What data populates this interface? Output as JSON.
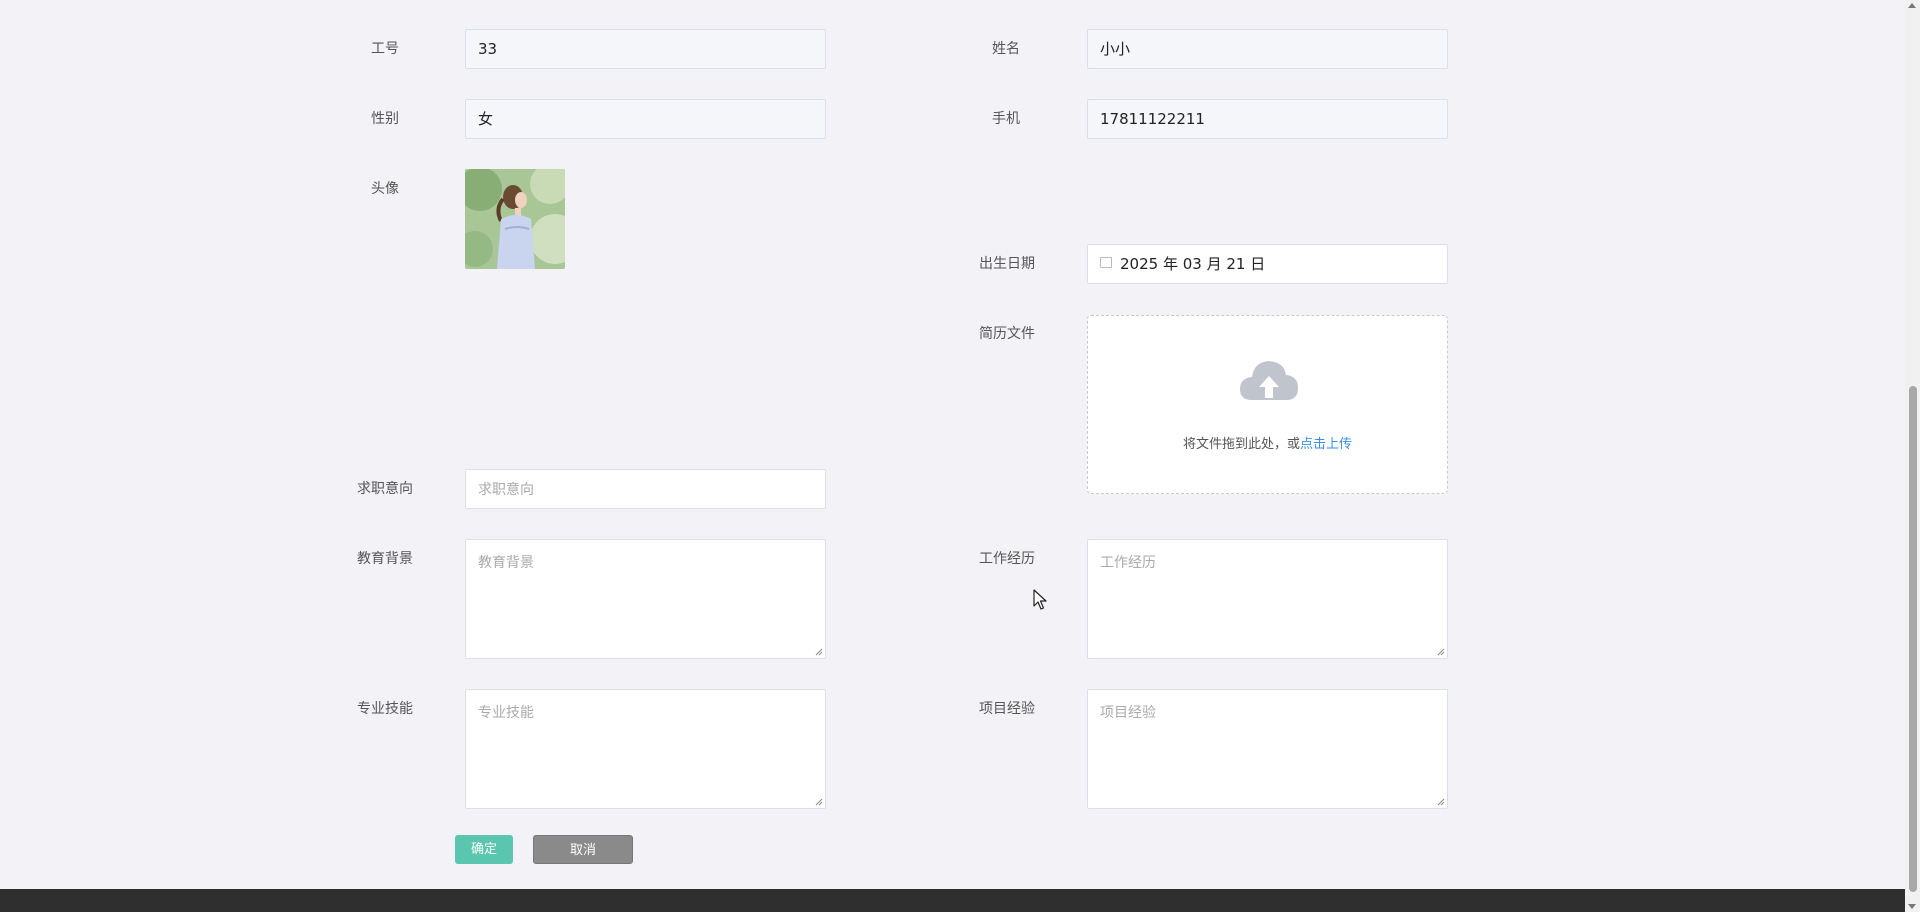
{
  "form": {
    "employee_id": {
      "label": "工号",
      "value": "33"
    },
    "name": {
      "label": "姓名",
      "value": "小小"
    },
    "gender": {
      "label": "性别",
      "value": "女"
    },
    "phone": {
      "label": "手机",
      "value": "17811122211"
    },
    "avatar": {
      "label": "头像"
    },
    "birth_date": {
      "label": "出生日期",
      "value": "2025 年 03 月 21 日"
    },
    "resume_file": {
      "label": "简历文件",
      "hint": "将文件拖到此处，或",
      "link": "点击上传"
    },
    "job_intention": {
      "label": "求职意向",
      "placeholder": "求职意向"
    },
    "education": {
      "label": "教育背景",
      "placeholder": "教育背景"
    },
    "work_experience": {
      "label": "工作经历",
      "placeholder": "工作经历"
    },
    "skills": {
      "label": "专业技能",
      "placeholder": "专业技能"
    },
    "project_experience": {
      "label": "项目经验",
      "placeholder": "项目经验"
    }
  },
  "buttons": {
    "confirm": "确定",
    "cancel": "取消"
  },
  "colors": {
    "background": "#f3f3f7",
    "confirm_button": "#5bc6b0",
    "cancel_button": "#8a8a8a",
    "link": "#3a8ee6",
    "footer": "#2f2f2f"
  },
  "icons": {
    "date": "calendar-icon",
    "upload": "cloud-upload-icon"
  }
}
